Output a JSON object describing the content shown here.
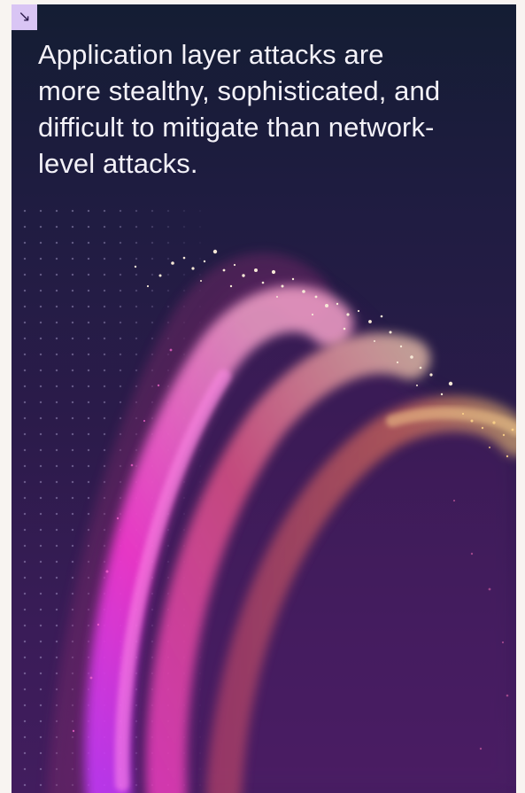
{
  "card": {
    "corner_icon": "arrow-down-right-icon",
    "corner_glyph": "↘",
    "headline": "Application layer attacks are more stealthy, sophisticated, and difficult to mitigate than network-level attacks."
  },
  "colors": {
    "background_top": "#141d33",
    "background_bottom": "#421d5e",
    "badge": "#d9c5f4",
    "text": "#f3f1f8",
    "swirl_magenta": "#ff3ad7",
    "swirl_pink": "#f05a8a",
    "swirl_gold": "#f3c37a"
  }
}
